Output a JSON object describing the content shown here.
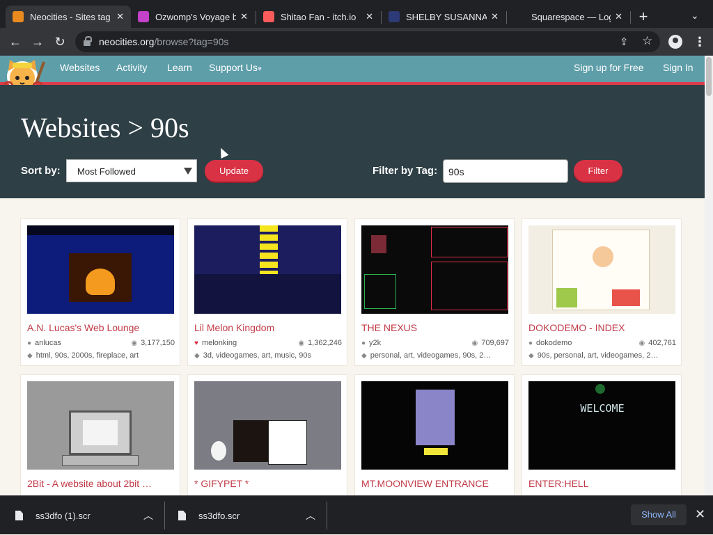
{
  "browser": {
    "tabs": [
      {
        "title": "Neocities - Sites tag",
        "favicon_color": "#e98b1e",
        "active": true
      },
      {
        "title": "Ozwomp's Voyage b",
        "favicon_color": "#c441c9"
      },
      {
        "title": "Shitao Fan - itch.io",
        "favicon_color": "#fa5c5c"
      },
      {
        "title": "SHELBY SUSANNA",
        "favicon_color": "#2c3a77"
      },
      {
        "title": "Squarespace — Log",
        "favicon_color": "#202124"
      }
    ],
    "url_domain": "neocities.org",
    "url_path": "/browse?tag=90s"
  },
  "site": {
    "nav": {
      "websites": "Websites",
      "activity": "Activity",
      "learn": "Learn",
      "support": "Support Us",
      "signup": "Sign up for Free",
      "signin": "Sign In"
    },
    "title": "Websites > 90s",
    "sort_label": "Sort by:",
    "sort_value": "Most Followed",
    "update_label": "Update",
    "filter_label": "Filter by Tag:",
    "filter_value": "90s",
    "filter_button": "Filter"
  },
  "sites": [
    {
      "title": "A.N. Lucas's Web Lounge",
      "owner": "anlucas",
      "views": "3,177,150",
      "tags": "html, 90s, 2000s, fireplace, art",
      "thumb_color": "#0d1b7a"
    },
    {
      "title": "Lil Melon Kingdom",
      "owner": "melonking",
      "views": "1,362,246",
      "tags": "3d, videogames, art, music, 90s",
      "thumb_color": "#1b1d5e"
    },
    {
      "title": "THE NEXUS",
      "owner": "y2k",
      "views": "709,697",
      "tags": "personal, art, videogames, 90s, 2…",
      "thumb_color": "#0a0a0a"
    },
    {
      "title": "DOKODEMO - INDEX",
      "owner": "dokodemo",
      "views": "402,761",
      "tags": "90s, personal, art, videogames, 2…",
      "thumb_color": "#f2eee4"
    },
    {
      "title": "2Bit - A website about 2bit …",
      "thumb_color": "#9a9a9a"
    },
    {
      "title": "* GIFYPET *",
      "thumb_color": "#7c7c84"
    },
    {
      "title": "MT.MOONVIEW ENTRANCE",
      "thumb_color": "#050505"
    },
    {
      "title": "ENTER:HELL",
      "thumb_color": "#050505"
    }
  ],
  "downloads": {
    "items": [
      {
        "name": "ss3dfo (1).scr"
      },
      {
        "name": "ss3dfo.scr"
      }
    ],
    "show_all": "Show All"
  }
}
